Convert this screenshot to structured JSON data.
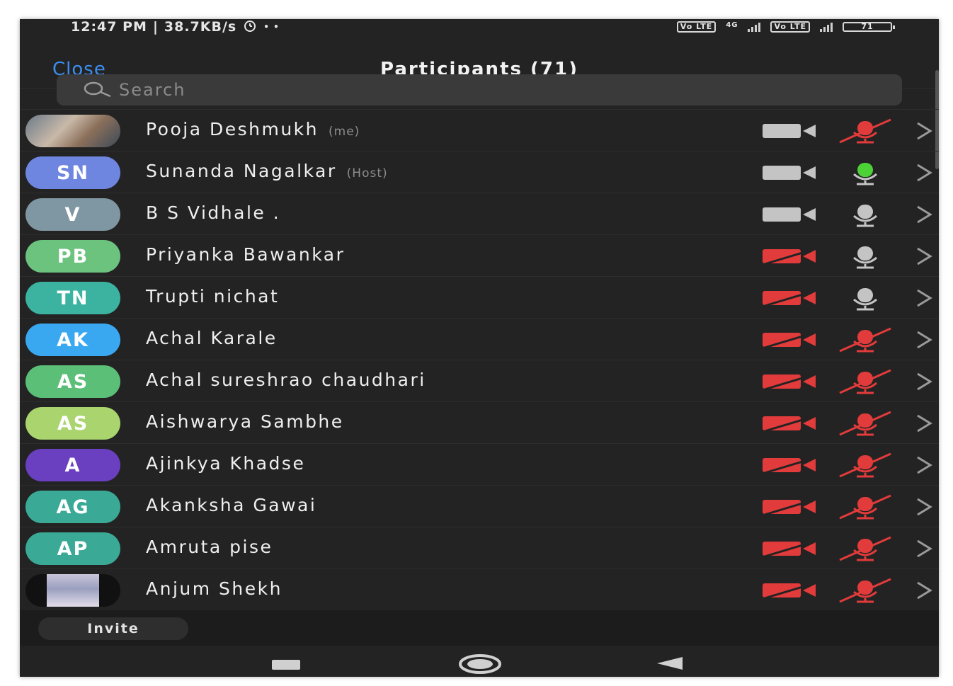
{
  "status_bar": {
    "time": "12:47 PM",
    "net_speed": "38.7KB/s",
    "dots": "• •",
    "volte1": "Vo LTE",
    "network": "4G",
    "volte2": "Vo LTE",
    "battery": "71"
  },
  "header": {
    "close_label": "Close",
    "title": "Participants (71)"
  },
  "search": {
    "placeholder": "Search"
  },
  "participants": [
    {
      "avatar": "",
      "name": "Pooja Deshmukh",
      "tag": "(me)",
      "color": "",
      "video": "off-gray",
      "audio": "muted"
    },
    {
      "avatar": "SN",
      "name": "Sunanda Nagalkar",
      "tag": "(Host)",
      "color": "#6f86e0",
      "video": "off-gray",
      "audio": "active"
    },
    {
      "avatar": "V",
      "name": "B S Vidhale .",
      "tag": "",
      "color": "#7f97a3",
      "video": "off-gray",
      "audio": "off-gray"
    },
    {
      "avatar": "PB",
      "name": "Priyanka Bawankar",
      "tag": "",
      "color": "#6cc37e",
      "video": "muted",
      "audio": "off-gray"
    },
    {
      "avatar": "TN",
      "name": "Trupti nichat",
      "tag": "",
      "color": "#3bb3a0",
      "video": "muted",
      "audio": "off-gray"
    },
    {
      "avatar": "AK",
      "name": "Achal Karale",
      "tag": "",
      "color": "#3aa8f0",
      "video": "muted",
      "audio": "muted"
    },
    {
      "avatar": "AS",
      "name": "Achal sureshrao chaudhari",
      "tag": "",
      "color": "#5cbf78",
      "video": "muted",
      "audio": "muted"
    },
    {
      "avatar": "AS",
      "name": "Aishwarya Sambhe",
      "tag": "",
      "color": "#a9d46e",
      "video": "muted",
      "audio": "muted"
    },
    {
      "avatar": "A",
      "name": "Ajinkya Khadse",
      "tag": "",
      "color": "#6a3fc0",
      "video": "muted",
      "audio": "muted"
    },
    {
      "avatar": "AG",
      "name": "Akanksha Gawai",
      "tag": "",
      "color": "#3aa996",
      "video": "muted",
      "audio": "muted"
    },
    {
      "avatar": "AP",
      "name": "Amruta pise",
      "tag": "",
      "color": "#3aa996",
      "video": "muted",
      "audio": "muted"
    },
    {
      "avatar": "",
      "name": "Anjum Shekh",
      "tag": "",
      "color": "",
      "video": "muted",
      "audio": "muted"
    }
  ],
  "footer": {
    "invite_label": "Invite"
  },
  "colors": {
    "accent": "#3c8ef0",
    "muted_red": "#e23b3b",
    "active_green": "#4cd137",
    "icon_gray": "#c4c4c4"
  }
}
